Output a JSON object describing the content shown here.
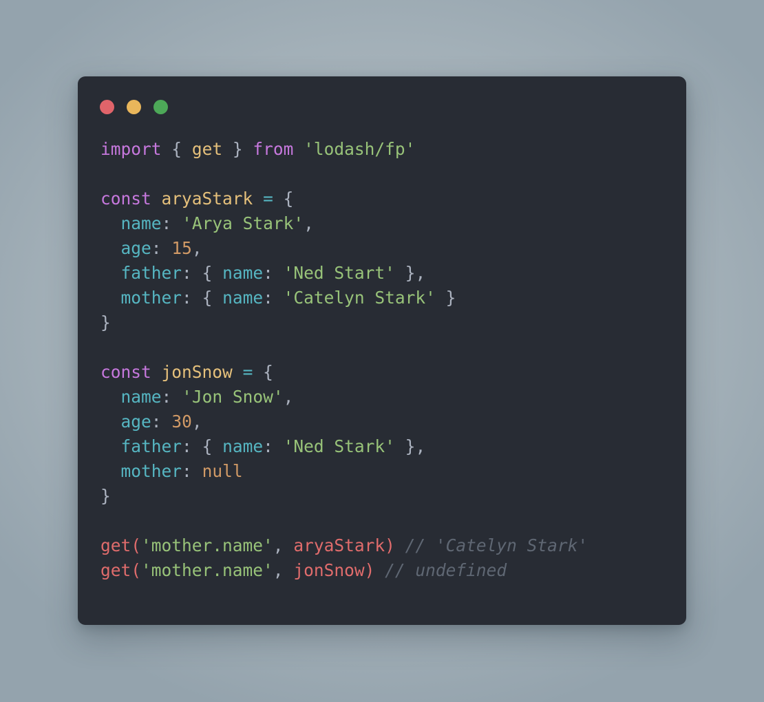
{
  "window": {
    "background_color": "#282c34",
    "page_background_color": "#a8b4bc",
    "traffic_lights": [
      {
        "name": "close",
        "color": "#e0646a"
      },
      {
        "name": "minimize",
        "color": "#e9b65b"
      },
      {
        "name": "maximize",
        "color": "#4da858"
      }
    ]
  },
  "theme": {
    "keyword": "#c678dd",
    "identifier": "#e5c07b",
    "string": "#98c379",
    "number": "#d19a66",
    "property": "#56b6c2",
    "punctuation": "#abb2bf",
    "operator": "#56b6c2",
    "call": "#e06c6c",
    "comment": "#5f6773"
  },
  "code": {
    "language": "javascript",
    "plain_text": "import { get } from 'lodash/fp'\n\nconst aryaStark = {\n  name: 'Arya Stark',\n  age: 15,\n  father: { name: 'Ned Start' },\n  mother: { name: 'Catelyn Stark' }\n}\n\nconst jonSnow = {\n  name: 'Jon Snow',\n  age: 30,\n  father: { name: 'Ned Stark' },\n  mother: null\n}\n\nget('mother.name', aryaStark) // 'Catelyn Stark'\nget('mother.name', jonSnow) // undefined",
    "lines": [
      {
        "n": 1,
        "tokens": [
          {
            "t": "import",
            "c": "kw"
          },
          {
            "t": " ",
            "c": "plain"
          },
          {
            "t": "{",
            "c": "punc"
          },
          {
            "t": " ",
            "c": "plain"
          },
          {
            "t": "get",
            "c": "id"
          },
          {
            "t": " ",
            "c": "plain"
          },
          {
            "t": "}",
            "c": "punc"
          },
          {
            "t": " ",
            "c": "plain"
          },
          {
            "t": "from",
            "c": "kw"
          },
          {
            "t": " ",
            "c": "plain"
          },
          {
            "t": "'lodash/fp'",
            "c": "str"
          }
        ]
      },
      {
        "n": 2,
        "tokens": []
      },
      {
        "n": 3,
        "tokens": [
          {
            "t": "const",
            "c": "kw"
          },
          {
            "t": " ",
            "c": "plain"
          },
          {
            "t": "aryaStark",
            "c": "id"
          },
          {
            "t": " ",
            "c": "plain"
          },
          {
            "t": "=",
            "c": "op"
          },
          {
            "t": " ",
            "c": "plain"
          },
          {
            "t": "{",
            "c": "punc"
          }
        ]
      },
      {
        "n": 4,
        "tokens": [
          {
            "t": "  ",
            "c": "plain"
          },
          {
            "t": "name",
            "c": "prop"
          },
          {
            "t": ":",
            "c": "punc"
          },
          {
            "t": " ",
            "c": "plain"
          },
          {
            "t": "'Arya Stark'",
            "c": "str"
          },
          {
            "t": ",",
            "c": "punc"
          }
        ]
      },
      {
        "n": 5,
        "tokens": [
          {
            "t": "  ",
            "c": "plain"
          },
          {
            "t": "age",
            "c": "prop"
          },
          {
            "t": ":",
            "c": "punc"
          },
          {
            "t": " ",
            "c": "plain"
          },
          {
            "t": "15",
            "c": "num"
          },
          {
            "t": ",",
            "c": "punc"
          }
        ]
      },
      {
        "n": 6,
        "tokens": [
          {
            "t": "  ",
            "c": "plain"
          },
          {
            "t": "father",
            "c": "prop"
          },
          {
            "t": ":",
            "c": "punc"
          },
          {
            "t": " ",
            "c": "plain"
          },
          {
            "t": "{",
            "c": "punc"
          },
          {
            "t": " ",
            "c": "plain"
          },
          {
            "t": "name",
            "c": "prop"
          },
          {
            "t": ":",
            "c": "punc"
          },
          {
            "t": " ",
            "c": "plain"
          },
          {
            "t": "'Ned Start'",
            "c": "str"
          },
          {
            "t": " ",
            "c": "plain"
          },
          {
            "t": "}",
            "c": "punc"
          },
          {
            "t": ",",
            "c": "punc"
          }
        ]
      },
      {
        "n": 7,
        "tokens": [
          {
            "t": "  ",
            "c": "plain"
          },
          {
            "t": "mother",
            "c": "prop"
          },
          {
            "t": ":",
            "c": "punc"
          },
          {
            "t": " ",
            "c": "plain"
          },
          {
            "t": "{",
            "c": "punc"
          },
          {
            "t": " ",
            "c": "plain"
          },
          {
            "t": "name",
            "c": "prop"
          },
          {
            "t": ":",
            "c": "punc"
          },
          {
            "t": " ",
            "c": "plain"
          },
          {
            "t": "'Catelyn Stark'",
            "c": "str"
          },
          {
            "t": " ",
            "c": "plain"
          },
          {
            "t": "}",
            "c": "punc"
          }
        ]
      },
      {
        "n": 8,
        "tokens": [
          {
            "t": "}",
            "c": "punc"
          }
        ]
      },
      {
        "n": 9,
        "tokens": []
      },
      {
        "n": 10,
        "tokens": [
          {
            "t": "const",
            "c": "kw"
          },
          {
            "t": " ",
            "c": "plain"
          },
          {
            "t": "jonSnow",
            "c": "id"
          },
          {
            "t": " ",
            "c": "plain"
          },
          {
            "t": "=",
            "c": "op"
          },
          {
            "t": " ",
            "c": "plain"
          },
          {
            "t": "{",
            "c": "punc"
          }
        ]
      },
      {
        "n": 11,
        "tokens": [
          {
            "t": "  ",
            "c": "plain"
          },
          {
            "t": "name",
            "c": "prop"
          },
          {
            "t": ":",
            "c": "punc"
          },
          {
            "t": " ",
            "c": "plain"
          },
          {
            "t": "'Jon Snow'",
            "c": "str"
          },
          {
            "t": ",",
            "c": "punc"
          }
        ]
      },
      {
        "n": 12,
        "tokens": [
          {
            "t": "  ",
            "c": "plain"
          },
          {
            "t": "age",
            "c": "prop"
          },
          {
            "t": ":",
            "c": "punc"
          },
          {
            "t": " ",
            "c": "plain"
          },
          {
            "t": "30",
            "c": "num"
          },
          {
            "t": ",",
            "c": "punc"
          }
        ]
      },
      {
        "n": 13,
        "tokens": [
          {
            "t": "  ",
            "c": "plain"
          },
          {
            "t": "father",
            "c": "prop"
          },
          {
            "t": ":",
            "c": "punc"
          },
          {
            "t": " ",
            "c": "plain"
          },
          {
            "t": "{",
            "c": "punc"
          },
          {
            "t": " ",
            "c": "plain"
          },
          {
            "t": "name",
            "c": "prop"
          },
          {
            "t": ":",
            "c": "punc"
          },
          {
            "t": " ",
            "c": "plain"
          },
          {
            "t": "'Ned Stark'",
            "c": "str"
          },
          {
            "t": " ",
            "c": "plain"
          },
          {
            "t": "}",
            "c": "punc"
          },
          {
            "t": ",",
            "c": "punc"
          }
        ]
      },
      {
        "n": 14,
        "tokens": [
          {
            "t": "  ",
            "c": "plain"
          },
          {
            "t": "mother",
            "c": "prop"
          },
          {
            "t": ":",
            "c": "punc"
          },
          {
            "t": " ",
            "c": "plain"
          },
          {
            "t": "null",
            "c": "num"
          }
        ]
      },
      {
        "n": 15,
        "tokens": [
          {
            "t": "}",
            "c": "punc"
          }
        ]
      },
      {
        "n": 16,
        "tokens": []
      },
      {
        "n": 17,
        "tokens": [
          {
            "t": "get",
            "c": "call"
          },
          {
            "t": "(",
            "c": "call"
          },
          {
            "t": "'mother.name'",
            "c": "str"
          },
          {
            "t": ",",
            "c": "punc"
          },
          {
            "t": " ",
            "c": "plain"
          },
          {
            "t": "aryaStark",
            "c": "call"
          },
          {
            "t": ")",
            "c": "call"
          },
          {
            "t": " ",
            "c": "plain"
          },
          {
            "t": "// 'Catelyn Stark'",
            "c": "comment"
          }
        ]
      },
      {
        "n": 18,
        "tokens": [
          {
            "t": "get",
            "c": "call"
          },
          {
            "t": "(",
            "c": "call"
          },
          {
            "t": "'mother.name'",
            "c": "str"
          },
          {
            "t": ",",
            "c": "punc"
          },
          {
            "t": " ",
            "c": "plain"
          },
          {
            "t": "jonSnow",
            "c": "call"
          },
          {
            "t": ")",
            "c": "call"
          },
          {
            "t": " ",
            "c": "plain"
          },
          {
            "t": "// undefined",
            "c": "comment"
          }
        ]
      }
    ]
  }
}
